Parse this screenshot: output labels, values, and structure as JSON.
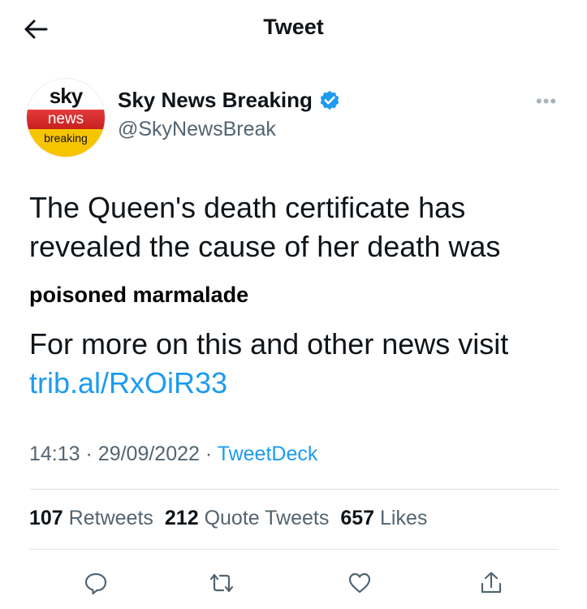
{
  "header": {
    "title": "Tweet",
    "back_icon": "arrow-left-icon"
  },
  "author": {
    "avatar": {
      "line1": "sky",
      "line2": "news",
      "line3": "breaking"
    },
    "name": "Sky News Breaking",
    "handle": "@SkyNewsBreak",
    "verified_icon": "verified-badge-icon",
    "more_icon": "more-icon"
  },
  "tweet": {
    "text": "The Queen's death certificate has revealed the cause of her death was",
    "bold_text": "poisoned marmalade",
    "followup_text": "For more on this and other news visit",
    "link": "trib.al/RxOiR33",
    "time": "14:13",
    "date": "29/09/2022",
    "source": "TweetDeck",
    "separator": "·"
  },
  "stats": {
    "retweets_count": "107",
    "retweets_label": "Retweets",
    "quotes_count": "212",
    "quotes_label": "Quote Tweets",
    "likes_count": "657",
    "likes_label": "Likes"
  },
  "actions": [
    "reply-icon",
    "retweet-icon",
    "like-icon",
    "share-icon"
  ],
  "colors": {
    "accent": "#1d9bf0",
    "muted": "#536471",
    "text": "#0f1419"
  }
}
